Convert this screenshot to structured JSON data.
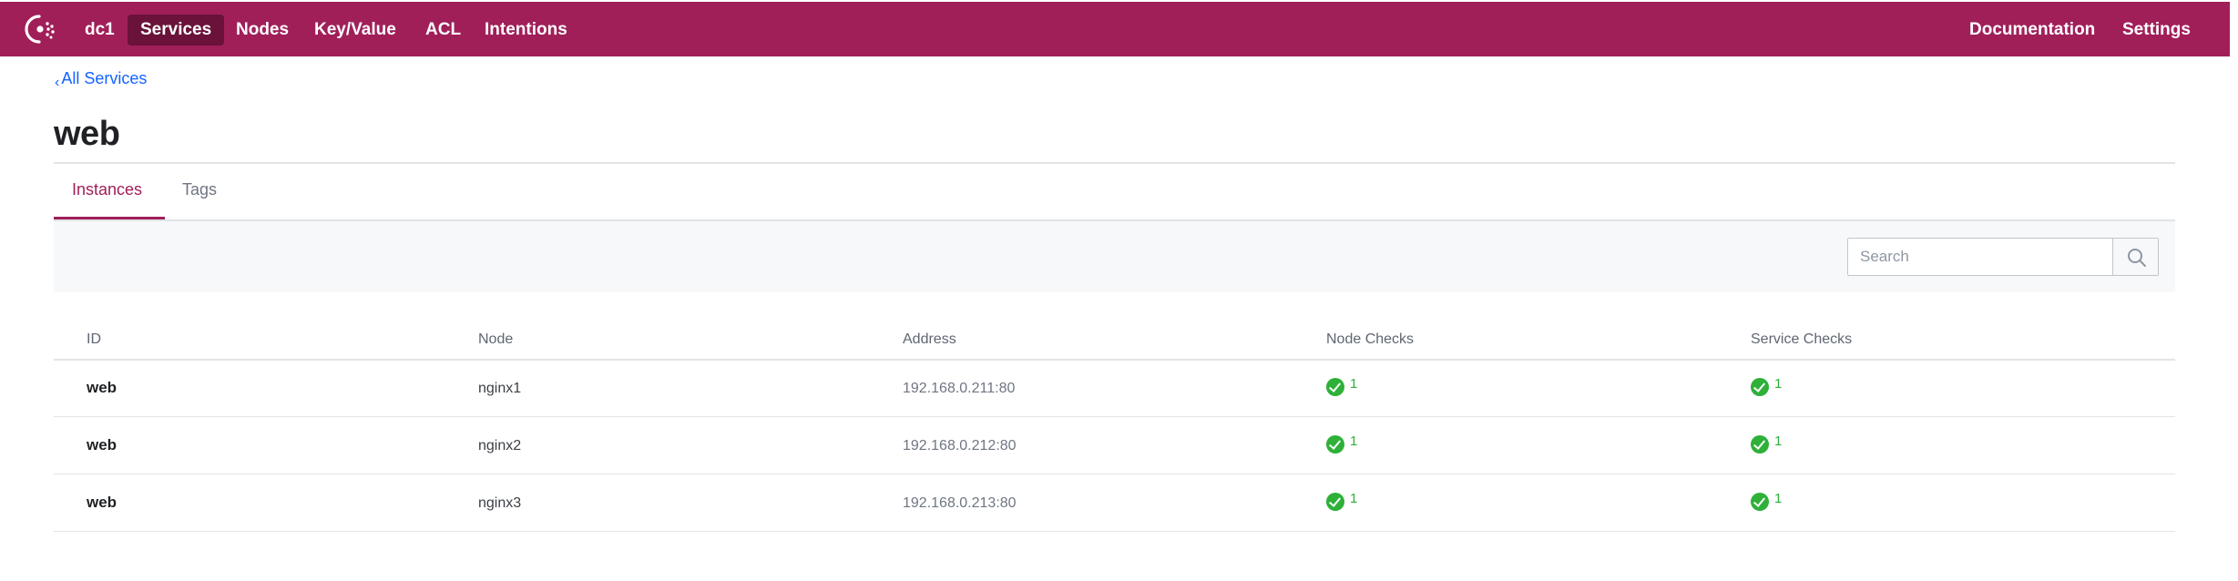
{
  "nav": {
    "datacenter": "dc1",
    "items": [
      {
        "label": "Services",
        "active": true
      },
      {
        "label": "Nodes"
      },
      {
        "label": "Key/Value"
      },
      {
        "label": "ACL"
      },
      {
        "label": "Intentions"
      }
    ],
    "right": [
      {
        "label": "Documentation"
      },
      {
        "label": "Settings"
      }
    ]
  },
  "breadcrumb": {
    "label": "All Services"
  },
  "page": {
    "title": "web"
  },
  "tabs": [
    {
      "label": "Instances",
      "active": true
    },
    {
      "label": "Tags"
    }
  ],
  "search": {
    "placeholder": "Search",
    "value": ""
  },
  "table": {
    "headers": [
      "ID",
      "Node",
      "Address",
      "Node Checks",
      "Service Checks"
    ],
    "rows": [
      {
        "id": "web",
        "node": "nginx1",
        "address": "192.168.0.211:80",
        "node_checks": "1",
        "service_checks": "1"
      },
      {
        "id": "web",
        "node": "nginx2",
        "address": "192.168.0.212:80",
        "node_checks": "1",
        "service_checks": "1"
      },
      {
        "id": "web",
        "node": "nginx3",
        "address": "192.168.0.213:80",
        "node_checks": "1",
        "service_checks": "1"
      }
    ]
  },
  "colors": {
    "brand": "#a01f59",
    "brand_active": "#6a1239",
    "link": "#1563ff",
    "passing": "#2eb039"
  },
  "icons": {
    "logo": "consul-logo-icon",
    "back": "chevron-left-icon",
    "search": "search-icon",
    "check": "check-circle-icon"
  }
}
